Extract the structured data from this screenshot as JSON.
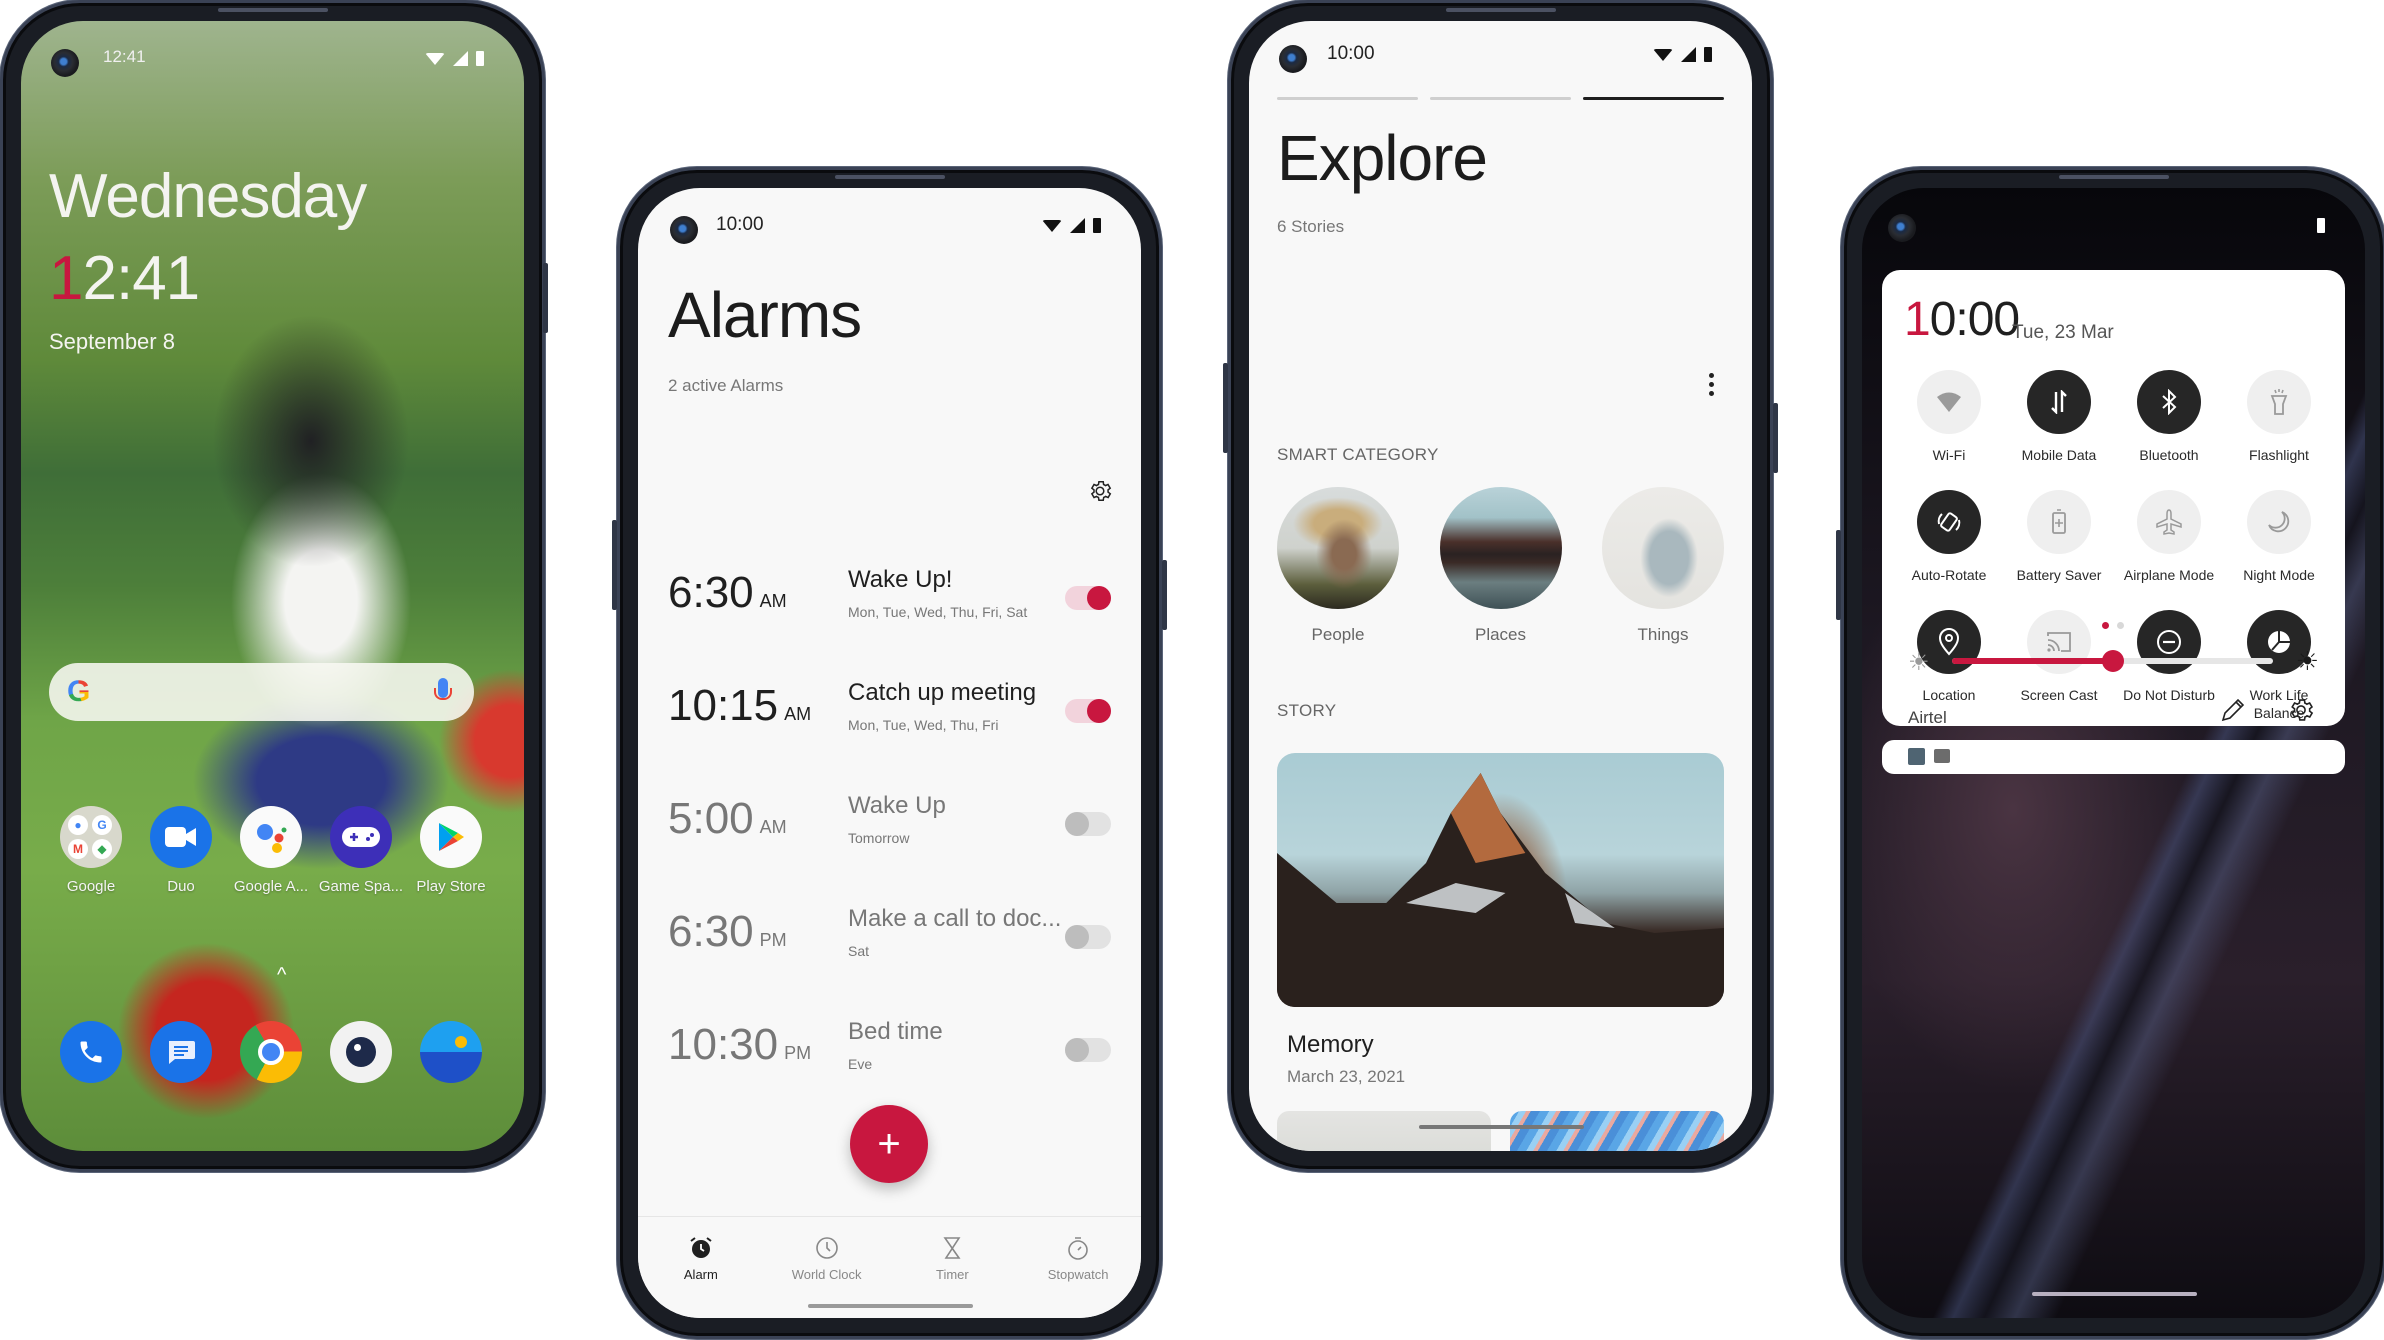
{
  "colors": {
    "accent": "#c8173f",
    "text_primary": "#1f1f1f",
    "text_secondary": "#777777",
    "toggle_on_track": "#f2d3dc",
    "toggle_off_track": "#e2e2e2"
  },
  "status_icons": [
    "wifi-icon",
    "signal-icon",
    "battery-icon"
  ],
  "home_screen": {
    "status_time": "12:41",
    "day": "Wednesday",
    "time_first_digit": "1",
    "time_rest": "2:41",
    "date": "September 8",
    "search_bar": {
      "logo": "G",
      "icon": "mic-icon"
    },
    "apps": [
      {
        "label": "Google",
        "icon": "google-folder-icon"
      },
      {
        "label": "Duo",
        "icon": "duo-video-icon"
      },
      {
        "label": "Google A...",
        "icon": "google-assistant-icon"
      },
      {
        "label": "Game Spa...",
        "icon": "game-controller-icon"
      },
      {
        "label": "Play Store",
        "icon": "play-store-icon"
      }
    ],
    "dock": [
      {
        "icon": "phone-icon"
      },
      {
        "icon": "messages-icon"
      },
      {
        "icon": "chrome-icon"
      },
      {
        "icon": "camera-icon"
      },
      {
        "icon": "gallery-icon"
      }
    ],
    "swipe_indicator": "^"
  },
  "alarms_screen": {
    "status_time": "10:00",
    "title": "Alarms",
    "subtitle": "2 active Alarms",
    "alarms": [
      {
        "time": "6:30",
        "period": "AM",
        "label": "Wake Up!",
        "repeat": "Mon, Tue, Wed, Thu, Fri, Sat",
        "enabled": true
      },
      {
        "time": "10:15",
        "period": "AM",
        "label": "Catch up meeting",
        "repeat": "Mon, Tue, Wed, Thu, Fri",
        "enabled": true
      },
      {
        "time": "5:00",
        "period": "AM",
        "label": "Wake Up",
        "repeat": "Tomorrow",
        "enabled": false
      },
      {
        "time": "6:30",
        "period": "PM",
        "label": "Make a call to doc...",
        "repeat": "Sat",
        "enabled": false
      },
      {
        "time": "10:30",
        "period": "PM",
        "label": "Bed time",
        "repeat": "Eve",
        "enabled": false
      }
    ],
    "fab_label": "+",
    "nav": [
      {
        "label": "Alarm",
        "icon": "alarm-clock-icon",
        "active": true
      },
      {
        "label": "World Clock",
        "icon": "clock-icon",
        "active": false
      },
      {
        "label": "Timer",
        "icon": "hourglass-icon",
        "active": false
      },
      {
        "label": "Stopwatch",
        "icon": "stopwatch-icon",
        "active": false
      }
    ]
  },
  "explore_screen": {
    "status_time": "10:00",
    "story_progress": {
      "total": 3,
      "current": 3
    },
    "title": "Explore",
    "subtitle": "6 Stories",
    "smart_category_label": "SMART CATEGORY",
    "categories": [
      {
        "label": "People"
      },
      {
        "label": "Places"
      },
      {
        "label": "Things"
      }
    ],
    "story_label": "STORY",
    "story": {
      "title": "Memory",
      "date": "March 23, 2021"
    }
  },
  "quick_settings": {
    "clock_first_digit": "1",
    "clock_rest": "0:00",
    "date": "Tue, 23 Mar",
    "tiles": [
      {
        "label": "Wi-Fi",
        "icon": "wifi-icon",
        "on": false
      },
      {
        "label": "Mobile Data",
        "icon": "mobile-data-icon",
        "on": true
      },
      {
        "label": "Bluetooth",
        "icon": "bluetooth-icon",
        "on": true
      },
      {
        "label": "Flashlight",
        "icon": "flashlight-icon",
        "on": false
      },
      {
        "label": "Auto-Rotate",
        "icon": "auto-rotate-icon",
        "on": true
      },
      {
        "label": "Battery Saver",
        "icon": "battery-saver-icon",
        "on": false
      },
      {
        "label": "Airplane Mode",
        "icon": "airplane-icon",
        "on": false
      },
      {
        "label": "Night Mode",
        "icon": "moon-icon",
        "on": false
      },
      {
        "label": "Location",
        "icon": "location-pin-icon",
        "on": true
      },
      {
        "label": "Screen Cast",
        "icon": "cast-icon",
        "on": false
      },
      {
        "label": "Do Not Disturb",
        "icon": "do-not-disturb-icon",
        "on": true
      },
      {
        "label": "Work Life Balance",
        "icon": "work-life-balance-icon",
        "on": true
      }
    ],
    "page": {
      "current": 1,
      "total": 2
    },
    "brightness_fraction": 0.5,
    "carrier": "Airtel",
    "notification_icons": [
      "image-icon",
      "message-icon"
    ]
  }
}
